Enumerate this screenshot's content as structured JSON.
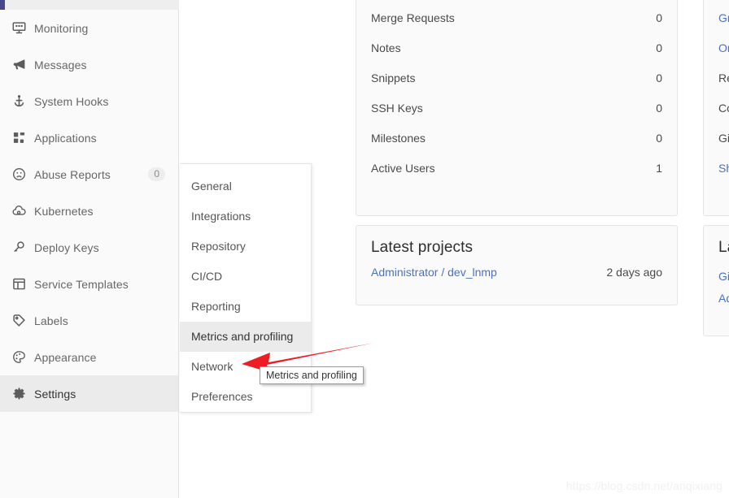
{
  "app": {
    "brand_color": "#46478a",
    "accent_link_color": "#4a72c0",
    "annotation_color": "#ee1c25"
  },
  "sidebar": {
    "items": [
      {
        "label": "Monitoring",
        "icon": "monitor-icon",
        "badge": null,
        "active": false
      },
      {
        "label": "Messages",
        "icon": "megaphone-icon",
        "badge": null,
        "active": false
      },
      {
        "label": "System Hooks",
        "icon": "hook-icon",
        "badge": null,
        "active": false
      },
      {
        "label": "Applications",
        "icon": "applications-icon",
        "badge": null,
        "active": false
      },
      {
        "label": "Abuse Reports",
        "icon": "sad-face-icon",
        "badge": "0",
        "active": false
      },
      {
        "label": "Kubernetes",
        "icon": "kubernetes-cloud-icon",
        "badge": null,
        "active": false
      },
      {
        "label": "Deploy Keys",
        "icon": "key-icon",
        "badge": null,
        "active": false
      },
      {
        "label": "Service Templates",
        "icon": "template-icon",
        "badge": null,
        "active": false
      },
      {
        "label": "Labels",
        "icon": "label-tag-icon",
        "badge": null,
        "active": false
      },
      {
        "label": "Appearance",
        "icon": "palette-icon",
        "badge": null,
        "active": false
      },
      {
        "label": "Settings",
        "icon": "gear-icon",
        "badge": null,
        "active": true
      }
    ]
  },
  "settings_flyout": {
    "items": [
      {
        "label": "General",
        "active": false
      },
      {
        "label": "Integrations",
        "active": false
      },
      {
        "label": "Repository",
        "active": false
      },
      {
        "label": "CI/CD",
        "active": false
      },
      {
        "label": "Reporting",
        "active": false
      },
      {
        "label": "Metrics and profiling",
        "active": true
      },
      {
        "label": "Network",
        "active": false
      },
      {
        "label": "Preferences",
        "active": false
      }
    ]
  },
  "statistics": {
    "rows": [
      {
        "label": "Merge Requests",
        "value": "0"
      },
      {
        "label": "Notes",
        "value": "0"
      },
      {
        "label": "Snippets",
        "value": "0"
      },
      {
        "label": "SSH Keys",
        "value": "0"
      },
      {
        "label": "Milestones",
        "value": "0"
      },
      {
        "label": "Active Users",
        "value": "1"
      }
    ]
  },
  "latest_projects": {
    "title": "Latest projects",
    "rows": [
      {
        "name": "Administrator / dev_lnmp",
        "time": "2 days ago"
      }
    ]
  },
  "features_panel": {
    "rows": [
      {
        "text": "Gr",
        "link": true
      },
      {
        "text": "On",
        "link": true
      },
      {
        "text": "Re",
        "link": false
      },
      {
        "text": "Co",
        "link": false
      },
      {
        "text": "Git",
        "link": false
      },
      {
        "text": "Sh",
        "link": true
      }
    ]
  },
  "latest_panel_right": {
    "title": "La",
    "rows": [
      {
        "text": "Git"
      },
      {
        "text": "Ad"
      }
    ]
  },
  "tooltip": {
    "text": "Metrics and profiling"
  },
  "watermark": {
    "text": "https://blog.csdn.net/anqixiang"
  }
}
